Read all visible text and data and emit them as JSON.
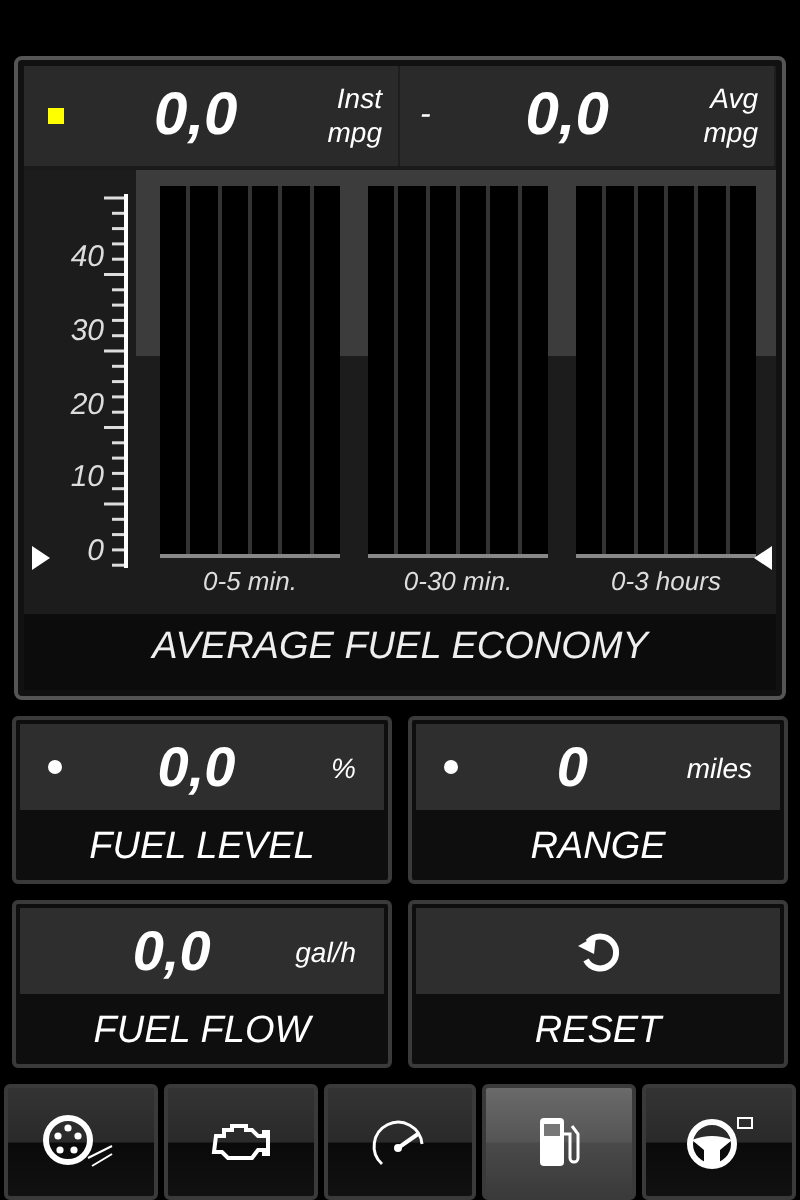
{
  "header": {
    "color": "#ffff00",
    "readings": [
      {
        "value": "0,0",
        "unit_top": "Inst",
        "unit_bottom": "mpg"
      },
      {
        "prefix": "-",
        "value": "0,0",
        "unit_top": "Avg",
        "unit_bottom": "mpg"
      }
    ]
  },
  "chart": {
    "title": "AVERAGE FUEL ECONOMY",
    "yticks": [
      "40",
      "30",
      "20",
      "10",
      "0"
    ],
    "groups": [
      "0-5 min.",
      "0-30 min.",
      "0-3 hours"
    ]
  },
  "tiles": [
    {
      "kind": "reading",
      "color": "#ffffff",
      "value": "0,0",
      "unit": "%",
      "label": "FUEL LEVEL"
    },
    {
      "kind": "reading",
      "color": "#ffffff",
      "value": "0",
      "unit": "miles",
      "label": "RANGE"
    },
    {
      "kind": "reading",
      "value": "0,0",
      "unit": "gal/h",
      "label": "FUEL FLOW"
    },
    {
      "kind": "action",
      "label": "RESET"
    }
  ],
  "tabs": [
    {
      "kind": "tire",
      "selected": false
    },
    {
      "kind": "engine",
      "selected": false
    },
    {
      "kind": "gauge",
      "selected": false
    },
    {
      "kind": "fuel",
      "selected": true
    },
    {
      "kind": "steering",
      "selected": false
    }
  ]
}
